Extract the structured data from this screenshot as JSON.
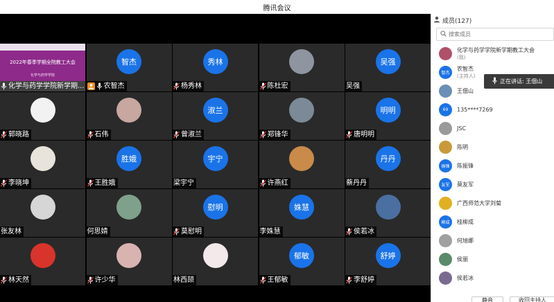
{
  "window": {
    "title": "腾讯会议"
  },
  "grid": [
    {
      "name": "化学与药学学院新学期...",
      "avatar_type": "banner",
      "mic": "on",
      "host": false,
      "banner_title": "2022年春季学期全院教工大会",
      "banner_sub": "化学与药学学院"
    },
    {
      "name": "农智杰",
      "avatar_type": "text",
      "avatar_text": "智杰",
      "mic": "on",
      "host": true
    },
    {
      "name": "杨秀林",
      "avatar_type": "text",
      "avatar_text": "秀林",
      "mic": "muted",
      "host": false
    },
    {
      "name": "陈杜宏",
      "avatar_type": "photo",
      "photo_color": "#8e94a0",
      "mic": "muted",
      "host": false
    },
    {
      "name": "吴强",
      "avatar_type": "text",
      "avatar_text": "吴强",
      "mic": "none",
      "host": false
    },
    {
      "name": "郭晓路",
      "avatar_type": "photo",
      "photo_color": "#f2f2f2",
      "mic": "muted",
      "host": false
    },
    {
      "name": "石伟",
      "avatar_type": "photo",
      "photo_color": "#c7a7a0",
      "mic": "muted",
      "host": false
    },
    {
      "name": "曾淑兰",
      "avatar_type": "text",
      "avatar_text": "淑兰",
      "mic": "muted",
      "host": false
    },
    {
      "name": "郑锋华",
      "avatar_type": "photo",
      "photo_color": "#7b8a96",
      "mic": "muted",
      "host": false
    },
    {
      "name": "唐明明",
      "avatar_type": "text",
      "avatar_text": "明明",
      "mic": "muted",
      "host": false
    },
    {
      "name": "李晓坤",
      "avatar_type": "photo",
      "photo_color": "#e8e4dc",
      "mic": "muted",
      "host": false
    },
    {
      "name": "王胜娥",
      "avatar_type": "text",
      "avatar_text": "胜娥",
      "mic": "muted",
      "host": false
    },
    {
      "name": "梁宇宁",
      "avatar_type": "text",
      "avatar_text": "宇宁",
      "mic": "none",
      "host": false
    },
    {
      "name": "许燕红",
      "avatar_type": "photo",
      "photo_color": "#c98a4a",
      "mic": "muted",
      "host": false
    },
    {
      "name": "蔡丹丹",
      "avatar_type": "text",
      "avatar_text": "丹丹",
      "mic": "none",
      "host": false
    },
    {
      "name": "张友林",
      "avatar_type": "photo",
      "photo_color": "#d6d6d6",
      "mic": "none",
      "host": false
    },
    {
      "name": "何思婧",
      "avatar_type": "photo",
      "photo_color": "#7fa08a",
      "mic": "none",
      "host": false
    },
    {
      "name": "莫慰明",
      "avatar_type": "text",
      "avatar_text": "慰明",
      "mic": "muted",
      "host": false
    },
    {
      "name": "李姝慧",
      "avatar_type": "text",
      "avatar_text": "姝慧",
      "mic": "none",
      "host": false
    },
    {
      "name": "侯若冰",
      "avatar_type": "photo",
      "photo_color": "#4a6fa0",
      "mic": "muted",
      "host": false
    },
    {
      "name": "林天然",
      "avatar_type": "photo",
      "photo_color": "#d9342b",
      "mic": "muted",
      "host": false
    },
    {
      "name": "许少华",
      "avatar_type": "photo",
      "photo_color": "#d8b3b0",
      "mic": "muted",
      "host": false
    },
    {
      "name": "林西颉",
      "avatar_type": "photo",
      "photo_color": "#f3e9ea",
      "mic": "none",
      "host": false
    },
    {
      "name": "王郁敏",
      "avatar_type": "text",
      "avatar_text": "郁敏",
      "mic": "muted",
      "host": false
    },
    {
      "name": "李舒婷",
      "avatar_type": "text",
      "avatar_text": "舒婷",
      "mic": "muted",
      "host": false
    }
  ],
  "panel": {
    "header": "成员(127)",
    "search_placeholder": "搜索成员",
    "members": [
      {
        "name": "化学与药学学院新学期教工大会",
        "sub": "(我)",
        "avatar_type": "photo",
        "avatar_color": "#b0506a"
      },
      {
        "name": "农智杰",
        "sub": "(主持人)",
        "avatar_type": "text",
        "avatar_text": "智杰",
        "avatar_color": "#1a73e8"
      },
      {
        "name": "王佃山",
        "sub": "",
        "avatar_type": "photo",
        "avatar_color": "#6b8fb5"
      },
      {
        "name": "135****7269",
        "sub": "",
        "avatar_type": "text",
        "avatar_text": "69",
        "avatar_color": "#1a73e8"
      },
      {
        "name": "JSC",
        "sub": "",
        "avatar_type": "photo",
        "avatar_color": "#9a9a9a"
      },
      {
        "name": "陈明",
        "sub": "",
        "avatar_type": "photo",
        "avatar_color": "#c89a3a"
      },
      {
        "name": "陈振锋",
        "sub": "",
        "avatar_type": "text",
        "avatar_text": "振锋",
        "avatar_color": "#1a73e8"
      },
      {
        "name": "莫友军",
        "sub": "",
        "avatar_type": "text",
        "avatar_text": "友军",
        "avatar_color": "#1a73e8"
      },
      {
        "name": "广西师范大学刘菊",
        "sub": "",
        "avatar_type": "photo",
        "avatar_color": "#e0b020"
      },
      {
        "name": "桂柳成",
        "sub": "",
        "avatar_type": "text",
        "avatar_text": "柳成",
        "avatar_color": "#1a73e8"
      },
      {
        "name": "何旭娜",
        "sub": "",
        "avatar_type": "photo",
        "avatar_color": "#a0a0a0"
      },
      {
        "name": "侯丽",
        "sub": "",
        "avatar_type": "photo",
        "avatar_color": "#5a8a6a"
      },
      {
        "name": "侯若冰",
        "sub": "",
        "avatar_type": "photo",
        "avatar_color": "#7a6a90"
      }
    ],
    "speaking": "正在讲话: 王佃山",
    "footer": {
      "mute_all": "静音",
      "cancel_host": "收回主持人"
    }
  }
}
